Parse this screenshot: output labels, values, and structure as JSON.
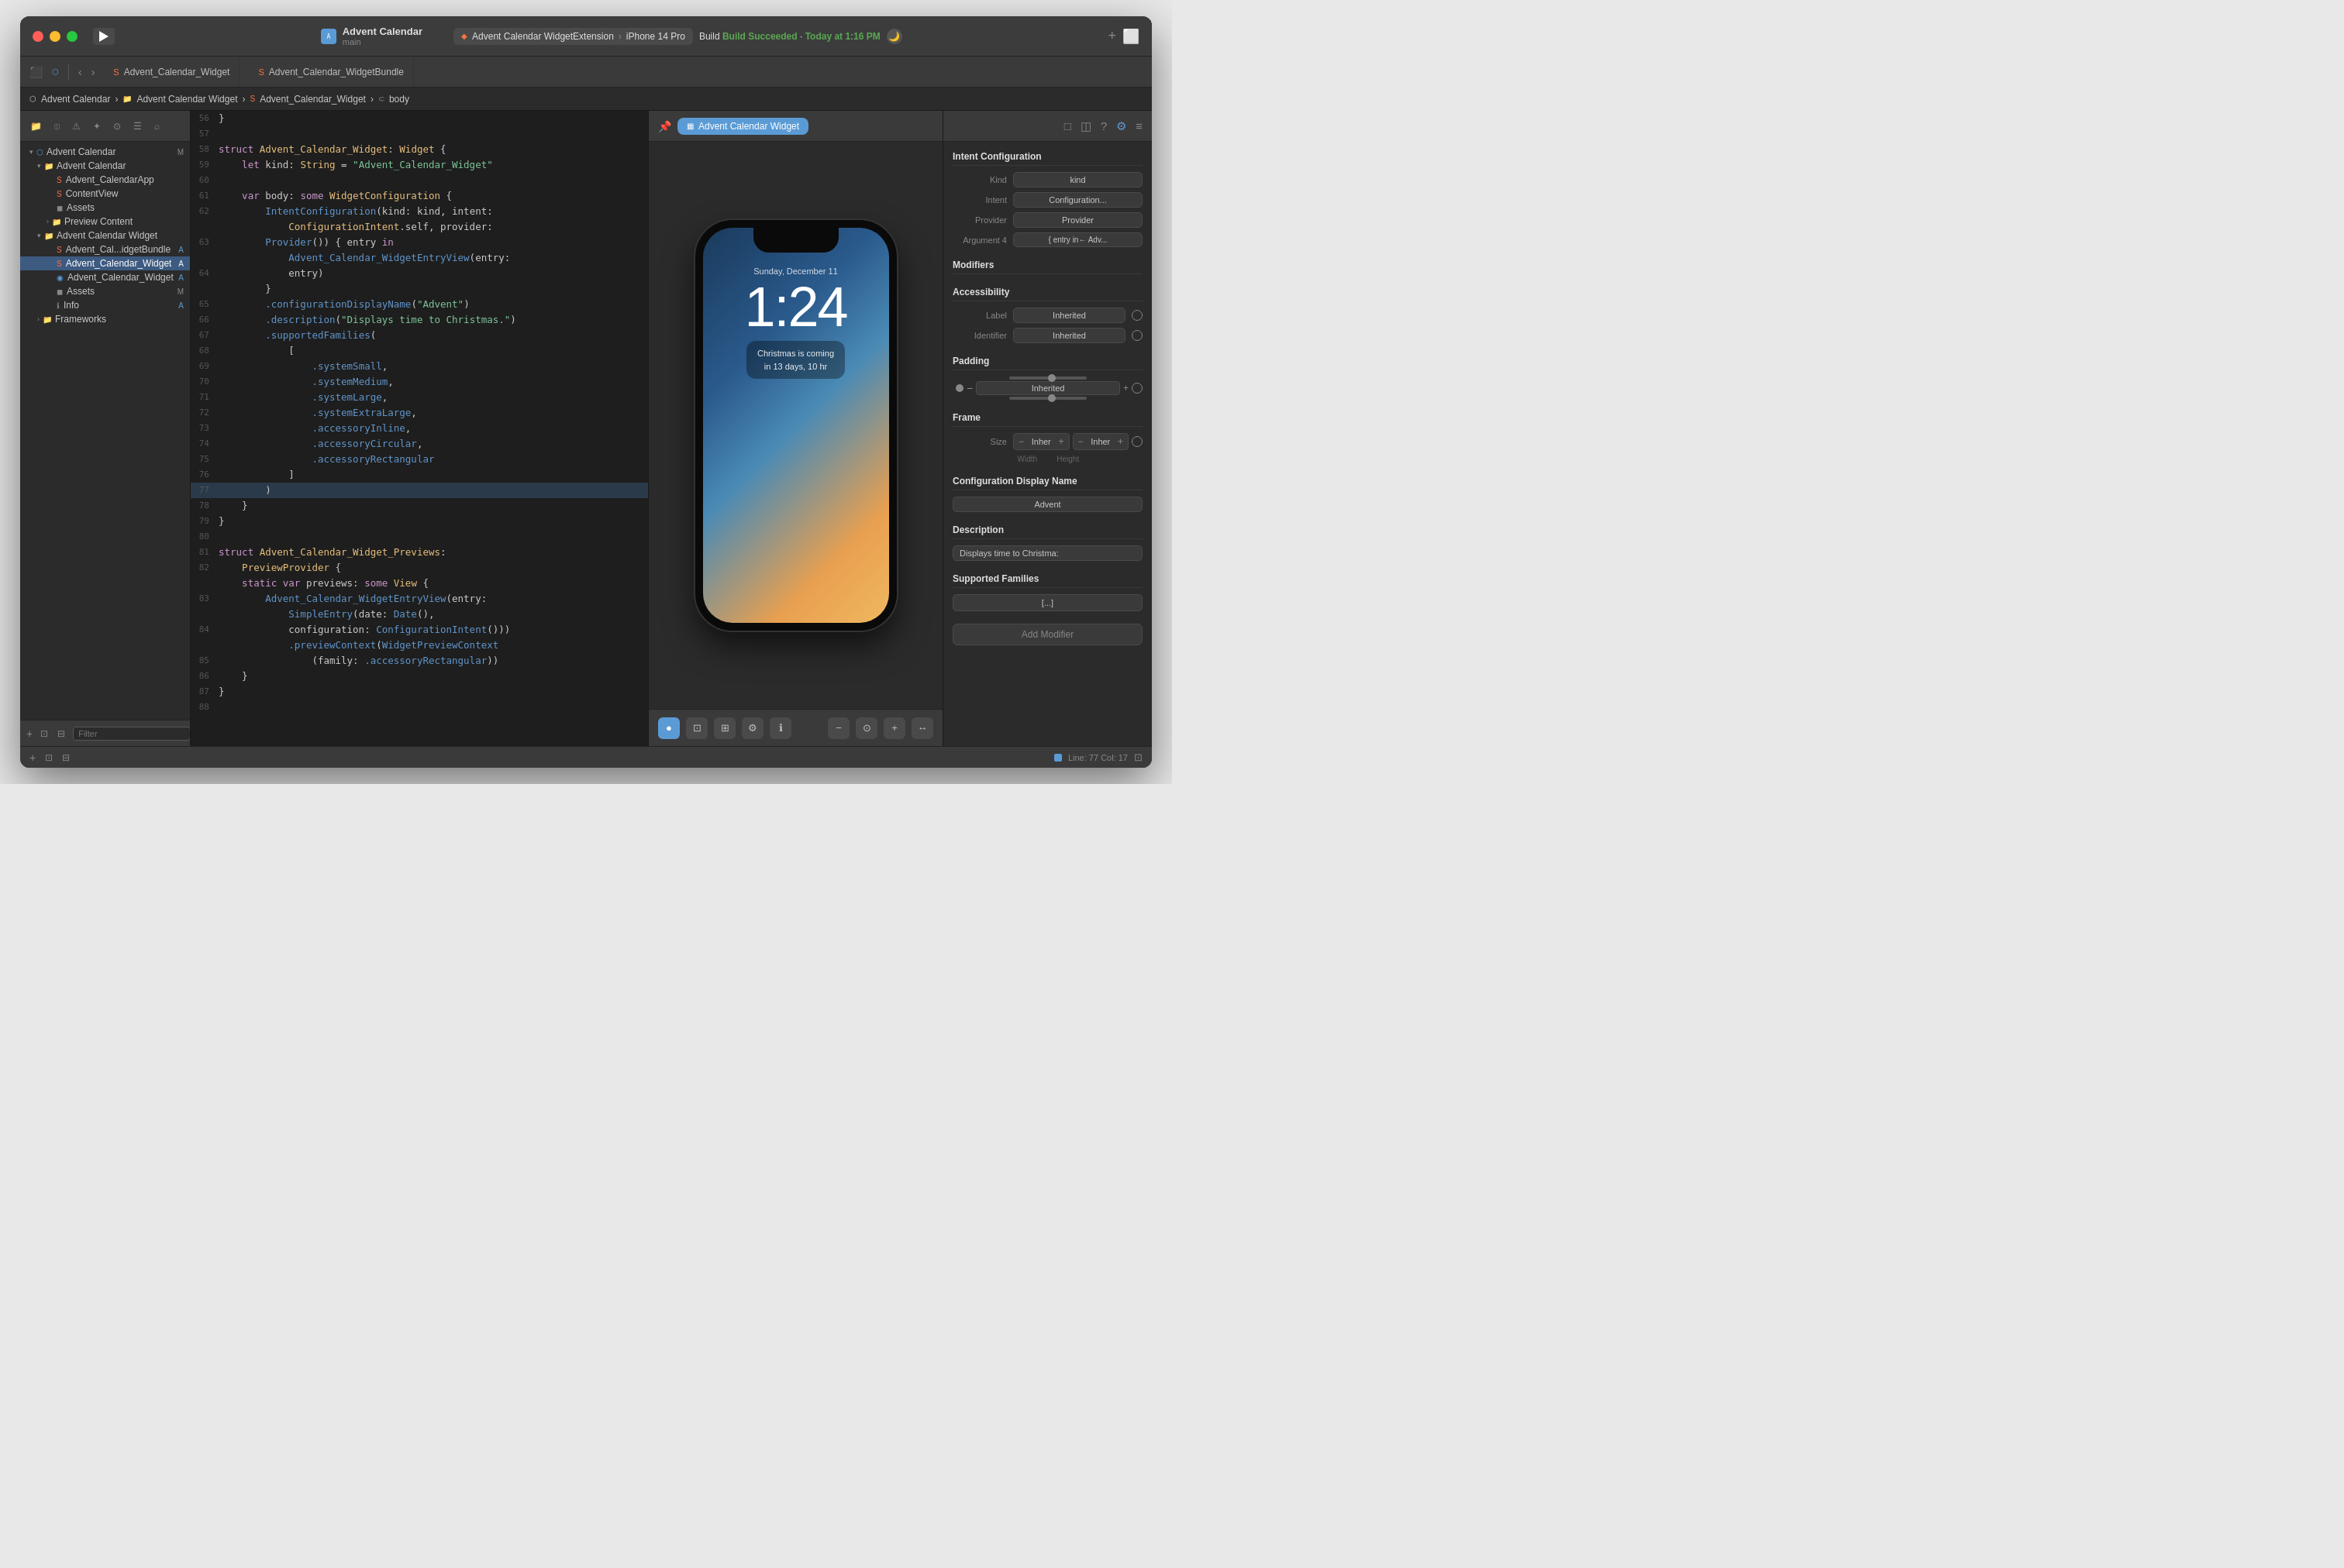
{
  "window": {
    "title": "Advent Calendar",
    "subtitle": "main"
  },
  "scheme": {
    "name": "Advent Calendar WidgetExtension",
    "device": "iPhone 14 Pro",
    "build_status": "Build Succeeded",
    "build_time": "Today at 1:16 PM"
  },
  "tabs": [
    {
      "label": "Advent_Calendar_Widget",
      "icon": "swift",
      "active": true
    },
    {
      "label": "Advent_Calendar_WidgetBundle",
      "icon": "swift",
      "active": false
    }
  ],
  "breadcrumb": {
    "items": [
      "Advent Calendar",
      "Advent Calendar Widget",
      "Advent_Calendar_Widget",
      "body"
    ]
  },
  "sidebar": {
    "items": [
      {
        "label": "Advent Calendar",
        "level": 0,
        "icon": "A",
        "badge": "M",
        "expanded": true,
        "type": "project"
      },
      {
        "label": "Advent Calendar",
        "level": 1,
        "icon": "folder",
        "badge": "",
        "expanded": true,
        "type": "group"
      },
      {
        "label": "Advent_CalendarApp",
        "level": 2,
        "icon": "swift",
        "badge": "",
        "type": "file"
      },
      {
        "label": "ContentView",
        "level": 2,
        "icon": "swift",
        "badge": "",
        "type": "file"
      },
      {
        "label": "Assets",
        "level": 2,
        "icon": "assets",
        "badge": "",
        "type": "file"
      },
      {
        "label": "Preview Content",
        "level": 2,
        "icon": "folder",
        "badge": "",
        "type": "group"
      },
      {
        "label": "Advent Calendar Widget",
        "level": 1,
        "icon": "folder",
        "badge": "",
        "expanded": true,
        "type": "group"
      },
      {
        "label": "Advent_Cal...idgetBundle",
        "level": 2,
        "icon": "swift",
        "badge": "A",
        "type": "file"
      },
      {
        "label": "Advent_Calendar_Widget",
        "level": 2,
        "icon": "swift",
        "badge": "A",
        "selected": true,
        "type": "file"
      },
      {
        "label": "Advent_Calendar_Widget",
        "level": 2,
        "icon": "intent",
        "badge": "A",
        "type": "file"
      },
      {
        "label": "Assets",
        "level": 2,
        "icon": "assets",
        "badge": "M",
        "type": "file"
      },
      {
        "label": "Info",
        "level": 2,
        "icon": "info",
        "badge": "A",
        "type": "file"
      },
      {
        "label": "Frameworks",
        "level": 1,
        "icon": "folder",
        "badge": "",
        "expanded": false,
        "type": "group"
      }
    ],
    "filter_placeholder": "Filter"
  },
  "code": {
    "lines": [
      {
        "num": 56,
        "content": "}"
      },
      {
        "num": 57,
        "content": ""
      },
      {
        "num": 58,
        "content": "struct Advent_Calendar_Widget: Widget {"
      },
      {
        "num": 59,
        "content": "    let kind: String = \"Advent_Calendar_Widget\""
      },
      {
        "num": 60,
        "content": ""
      },
      {
        "num": 61,
        "content": "    var body: some WidgetConfiguration {"
      },
      {
        "num": 62,
        "content": "        IntentConfiguration(kind: kind, intent:",
        "cont": "            ConfigurationIntent.self, provider:"
      },
      {
        "num": 63,
        "content": "        Provider()) { entry in",
        "cont": "            Advent_Calendar_WidgetEntryView(entry:"
      },
      {
        "num": 64,
        "content": "            entry)",
        "next": "        }"
      },
      {
        "num": 65,
        "content": "        .configurationDisplayName(\"Advent\")"
      },
      {
        "num": 66,
        "content": "        .description(\"Displays time to Christmas.\")"
      },
      {
        "num": 67,
        "content": "        .supportedFamilies("
      },
      {
        "num": 68,
        "content": "            ["
      },
      {
        "num": 69,
        "content": "                .systemSmall,"
      },
      {
        "num": 70,
        "content": "                .systemMedium,"
      },
      {
        "num": 71,
        "content": "                .systemLarge,"
      },
      {
        "num": 72,
        "content": "                .systemExtraLarge,"
      },
      {
        "num": 73,
        "content": "                .accessoryInline,"
      },
      {
        "num": 74,
        "content": "                .accessoryCircular,"
      },
      {
        "num": 75,
        "content": "                .accessoryRectangular"
      },
      {
        "num": 76,
        "content": "            ]"
      },
      {
        "num": 77,
        "content": "        )",
        "highlighted": true
      },
      {
        "num": 78,
        "content": "    }"
      },
      {
        "num": 79,
        "content": "}"
      },
      {
        "num": 80,
        "content": ""
      },
      {
        "num": 81,
        "content": "struct Advent_Calendar_Widget_Previews:"
      },
      {
        "num": 82,
        "content": "    PreviewProvider {",
        "cont": "    static var previews: some View {"
      },
      {
        "num": 83,
        "content": "        Advent_Calendar_WidgetEntryView(entry:",
        "cont": "            SimpleEntry(date: Date(),"
      },
      {
        "num": 84,
        "content": "            configuration: ConfigurationIntent())",
        "cont": "            .previewContext(WidgetPreviewContext"
      },
      {
        "num": 85,
        "content": "                (family: .accessoryRectangular))"
      },
      {
        "num": 86,
        "content": "    }"
      },
      {
        "num": 87,
        "content": "}"
      },
      {
        "num": 88,
        "content": ""
      }
    ]
  },
  "preview": {
    "widget_label": "Advent Calendar Widget",
    "phone": {
      "date_label": "Sunday, December 11",
      "time": "1:24",
      "widget_line1": "Christmas is coming",
      "widget_line2": "in 13 days, 10 hr"
    }
  },
  "inspector": {
    "title": "Intent Configuration",
    "fields": {
      "kind": "kind",
      "intent": "Configuration...",
      "provider": "Provider",
      "argument4": "{ entry in← Adv..."
    },
    "modifiers_title": "Modifiers",
    "accessibility": {
      "title": "Accessibility",
      "label_value": "Inherited",
      "identifier_value": "Inherited"
    },
    "padding": {
      "title": "Padding",
      "value": "Inherited"
    },
    "frame": {
      "title": "Frame",
      "size_label": "Size",
      "width_label": "Width",
      "height_label": "Height",
      "width_value": "Inher",
      "height_value": "Inher"
    },
    "configuration_display_name": {
      "title": "Configuration Display Name",
      "value": "Advent"
    },
    "description": {
      "title": "Description",
      "value": "Displays time to Christma:"
    },
    "supported_families": {
      "title": "Supported Families",
      "value": "[...]"
    },
    "add_modifier_label": "Add Modifier"
  },
  "status_bar": {
    "line_col": "Line: 77  Col: 17"
  },
  "icons": {
    "run": "▶",
    "back": "‹",
    "forward": "›",
    "disclosure_open": "▾",
    "disclosure_closed": "›",
    "folder": "📁",
    "swift_file": "S",
    "search": "⌕",
    "pin": "📌",
    "zoom_in": "+",
    "zoom_reset": "⊙",
    "zoom_out": "−",
    "grid": "⊞",
    "inspector1": "✦",
    "inspector2": "i",
    "inspector3": "?",
    "inspector4": "⚙",
    "inspector5": "≡"
  }
}
